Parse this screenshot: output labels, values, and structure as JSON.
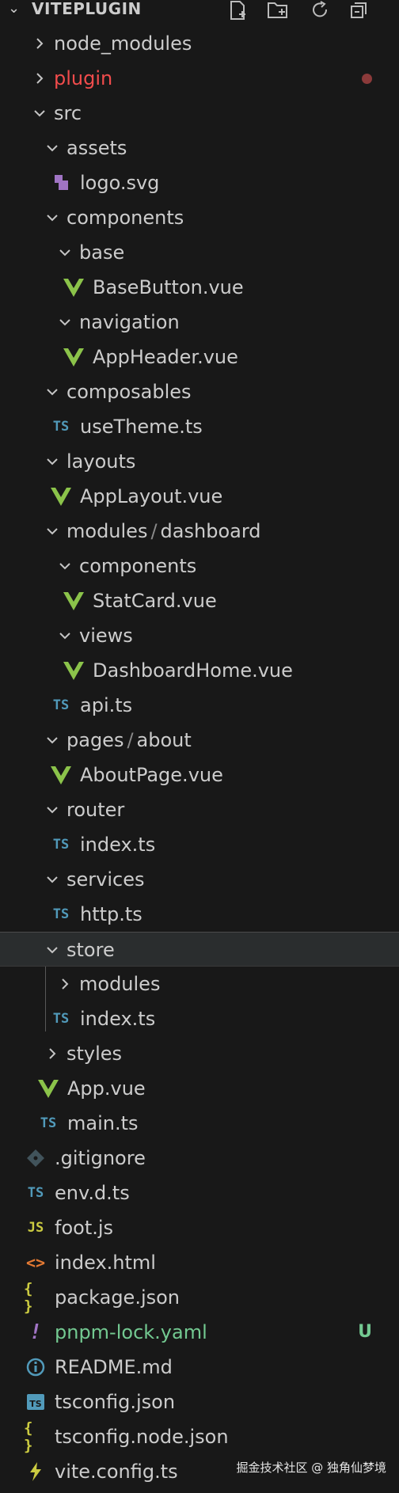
{
  "explorer": {
    "title": "VITEPLUGIN"
  },
  "tree": [
    {
      "label": "node_modules",
      "type": "folder",
      "expanded": false,
      "depth": 0
    },
    {
      "label": "plugin",
      "type": "folder",
      "expanded": false,
      "depth": 0,
      "status": "modified",
      "color": "#f14c4c"
    },
    {
      "label": "src",
      "type": "folder",
      "expanded": true,
      "depth": 0
    },
    {
      "label": "assets",
      "type": "folder",
      "expanded": true,
      "depth": 1
    },
    {
      "label": "logo.svg",
      "type": "svg",
      "depth": 2
    },
    {
      "label": "components",
      "type": "folder",
      "expanded": true,
      "depth": 1
    },
    {
      "label": "base",
      "type": "folder",
      "expanded": true,
      "depth": 2
    },
    {
      "label": "BaseButton.vue",
      "type": "vue",
      "depth": 3
    },
    {
      "label": "navigation",
      "type": "folder",
      "expanded": true,
      "depth": 2
    },
    {
      "label": "AppHeader.vue",
      "type": "vue",
      "depth": 3
    },
    {
      "label": "composables",
      "type": "folder",
      "expanded": true,
      "depth": 1
    },
    {
      "label": "useTheme.ts",
      "type": "ts",
      "depth": 2
    },
    {
      "label": "layouts",
      "type": "folder",
      "expanded": true,
      "depth": 1
    },
    {
      "label": "AppLayout.vue",
      "type": "vue",
      "depth": 2
    },
    {
      "label": "modules",
      "label2": "dashboard",
      "type": "folder",
      "expanded": true,
      "depth": 1
    },
    {
      "label": "components",
      "type": "folder",
      "expanded": true,
      "depth": 2
    },
    {
      "label": "StatCard.vue",
      "type": "vue",
      "depth": 3
    },
    {
      "label": "views",
      "type": "folder",
      "expanded": true,
      "depth": 2
    },
    {
      "label": "DashboardHome.vue",
      "type": "vue",
      "depth": 3
    },
    {
      "label": "api.ts",
      "type": "ts",
      "depth": 2
    },
    {
      "label": "pages",
      "label2": "about",
      "type": "folder",
      "expanded": true,
      "depth": 1
    },
    {
      "label": "AboutPage.vue",
      "type": "vue",
      "depth": 2
    },
    {
      "label": "router",
      "type": "folder",
      "expanded": true,
      "depth": 1
    },
    {
      "label": "index.ts",
      "type": "ts",
      "depth": 2
    },
    {
      "label": "services",
      "type": "folder",
      "expanded": true,
      "depth": 1
    },
    {
      "label": "http.ts",
      "type": "ts",
      "depth": 2
    },
    {
      "label": "store",
      "type": "folder",
      "expanded": true,
      "depth": 1,
      "selected": true
    },
    {
      "label": "modules",
      "type": "folder",
      "expanded": false,
      "depth": 2
    },
    {
      "label": "index.ts",
      "type": "ts",
      "depth": 2
    },
    {
      "label": "styles",
      "type": "folder",
      "expanded": false,
      "depth": 1
    },
    {
      "label": "App.vue",
      "type": "vue",
      "depth": 1
    },
    {
      "label": "main.ts",
      "type": "ts",
      "depth": 1
    },
    {
      "label": ".gitignore",
      "type": "git",
      "depth": 0
    },
    {
      "label": "env.d.ts",
      "type": "ts",
      "depth": 0
    },
    {
      "label": "foot.js",
      "type": "js",
      "depth": 0
    },
    {
      "label": "index.html",
      "type": "html",
      "depth": 0
    },
    {
      "label": "package.json",
      "type": "json",
      "depth": 0
    },
    {
      "label": "pnpm-lock.yaml",
      "type": "yaml",
      "depth": 0,
      "status": "untracked",
      "badge": "U",
      "color": "#73c991"
    },
    {
      "label": "README.md",
      "type": "info",
      "depth": 0
    },
    {
      "label": "tsconfig.json",
      "type": "tsconfig",
      "depth": 0
    },
    {
      "label": "tsconfig.node.json",
      "type": "json",
      "depth": 0
    },
    {
      "label": "vite.config.ts",
      "type": "vite",
      "depth": 0
    }
  ],
  "watermark": "掘金技术社区 @ 独角仙梦境"
}
